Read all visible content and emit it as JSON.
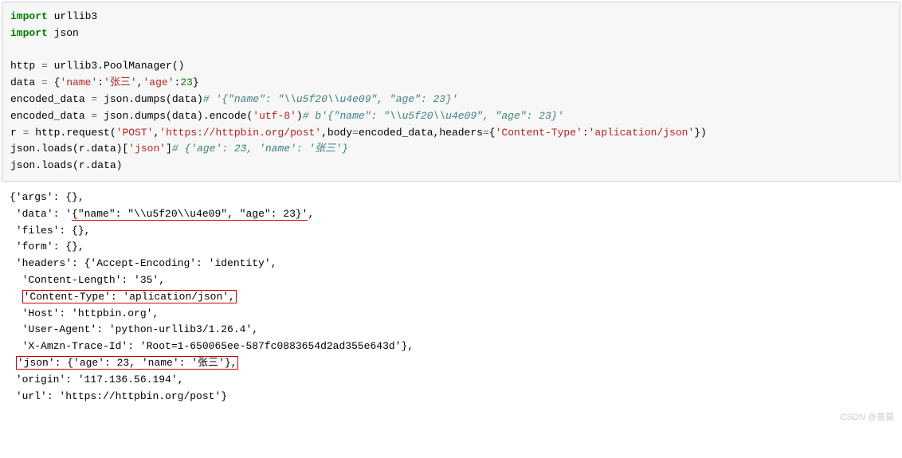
{
  "code": {
    "l1_kw1": "import",
    "l1_mod": " urllib3",
    "l2_kw1": "import",
    "l2_mod": " json",
    "l3": "",
    "l4_a": "http ",
    "l4_op": "=",
    "l4_b": " urllib3.PoolManager()",
    "l5_a": "data ",
    "l5_op": "=",
    "l5_b": " {",
    "l5_s1": "'name'",
    "l5_c": ":",
    "l5_s2": "'张三'",
    "l5_d": ",",
    "l5_s3": "'age'",
    "l5_e": ":",
    "l5_n1": "23",
    "l5_f": "}",
    "l6_a": "encoded_data ",
    "l6_op": "=",
    "l6_b": " json.dumps(data)",
    "l6_cmt": "# '{\"name\": \"\\\\u5f20\\\\u4e09\", \"age\": 23}'",
    "l7_a": "encoded_data ",
    "l7_op": "=",
    "l7_b": " json.dumps(data).encode(",
    "l7_s1": "'utf-8'",
    "l7_c": ")",
    "l7_cmt": "# b'{\"name\": \"\\\\u5f20\\\\u4e09\", \"age\": 23}'",
    "l8_a": "r ",
    "l8_op": "=",
    "l8_b": " http.request(",
    "l8_s1": "'POST'",
    "l8_c": ",",
    "l8_s2": "'https://httpbin.org/post'",
    "l8_d": ",body",
    "l8_op2": "=",
    "l8_e": "encoded_data,headers",
    "l8_op3": "=",
    "l8_f": "{",
    "l8_s3": "'Content-Type'",
    "l8_g": ":",
    "l8_s4": "'aplication/json'",
    "l8_h": "})",
    "l9_a": "json.loads(r.data)[",
    "l9_s1": "'json'",
    "l9_b": "]",
    "l9_cmt": "# {'age': 23, 'name': '张三'}",
    "l10_a": "json.loads(r.data)"
  },
  "output": {
    "o1": "{'args': {},",
    "o2a": " 'data': '",
    "o2b": "{\"name\": \"\\\\u5f20\\\\u4e09\", \"age\": 23}'",
    "o2c": ",",
    "o3": " 'files': {},",
    "o4": " 'form': {},",
    "o5": " 'headers': {'Accept-Encoding': 'identity',",
    "o6": "  'Content-Length': '35',",
    "o7a": "  ",
    "o7b": "'Content-Type': 'aplication/json',",
    "o8": "  'Host': 'httpbin.org',",
    "o9": "  'User-Agent': 'python-urllib3/1.26.4',",
    "o10": "  'X-Amzn-Trace-Id': 'Root=1-650065ee-587fc0883654d2ad355e643d'},",
    "o11a": " ",
    "o11b": "'json': {'age': 23, 'name': '张三'},",
    "o12": " 'origin': '117.136.56.194',",
    "o13": " 'url': 'https://httpbin.org/post'}"
  },
  "watermark": "CSDN @蔷莫"
}
